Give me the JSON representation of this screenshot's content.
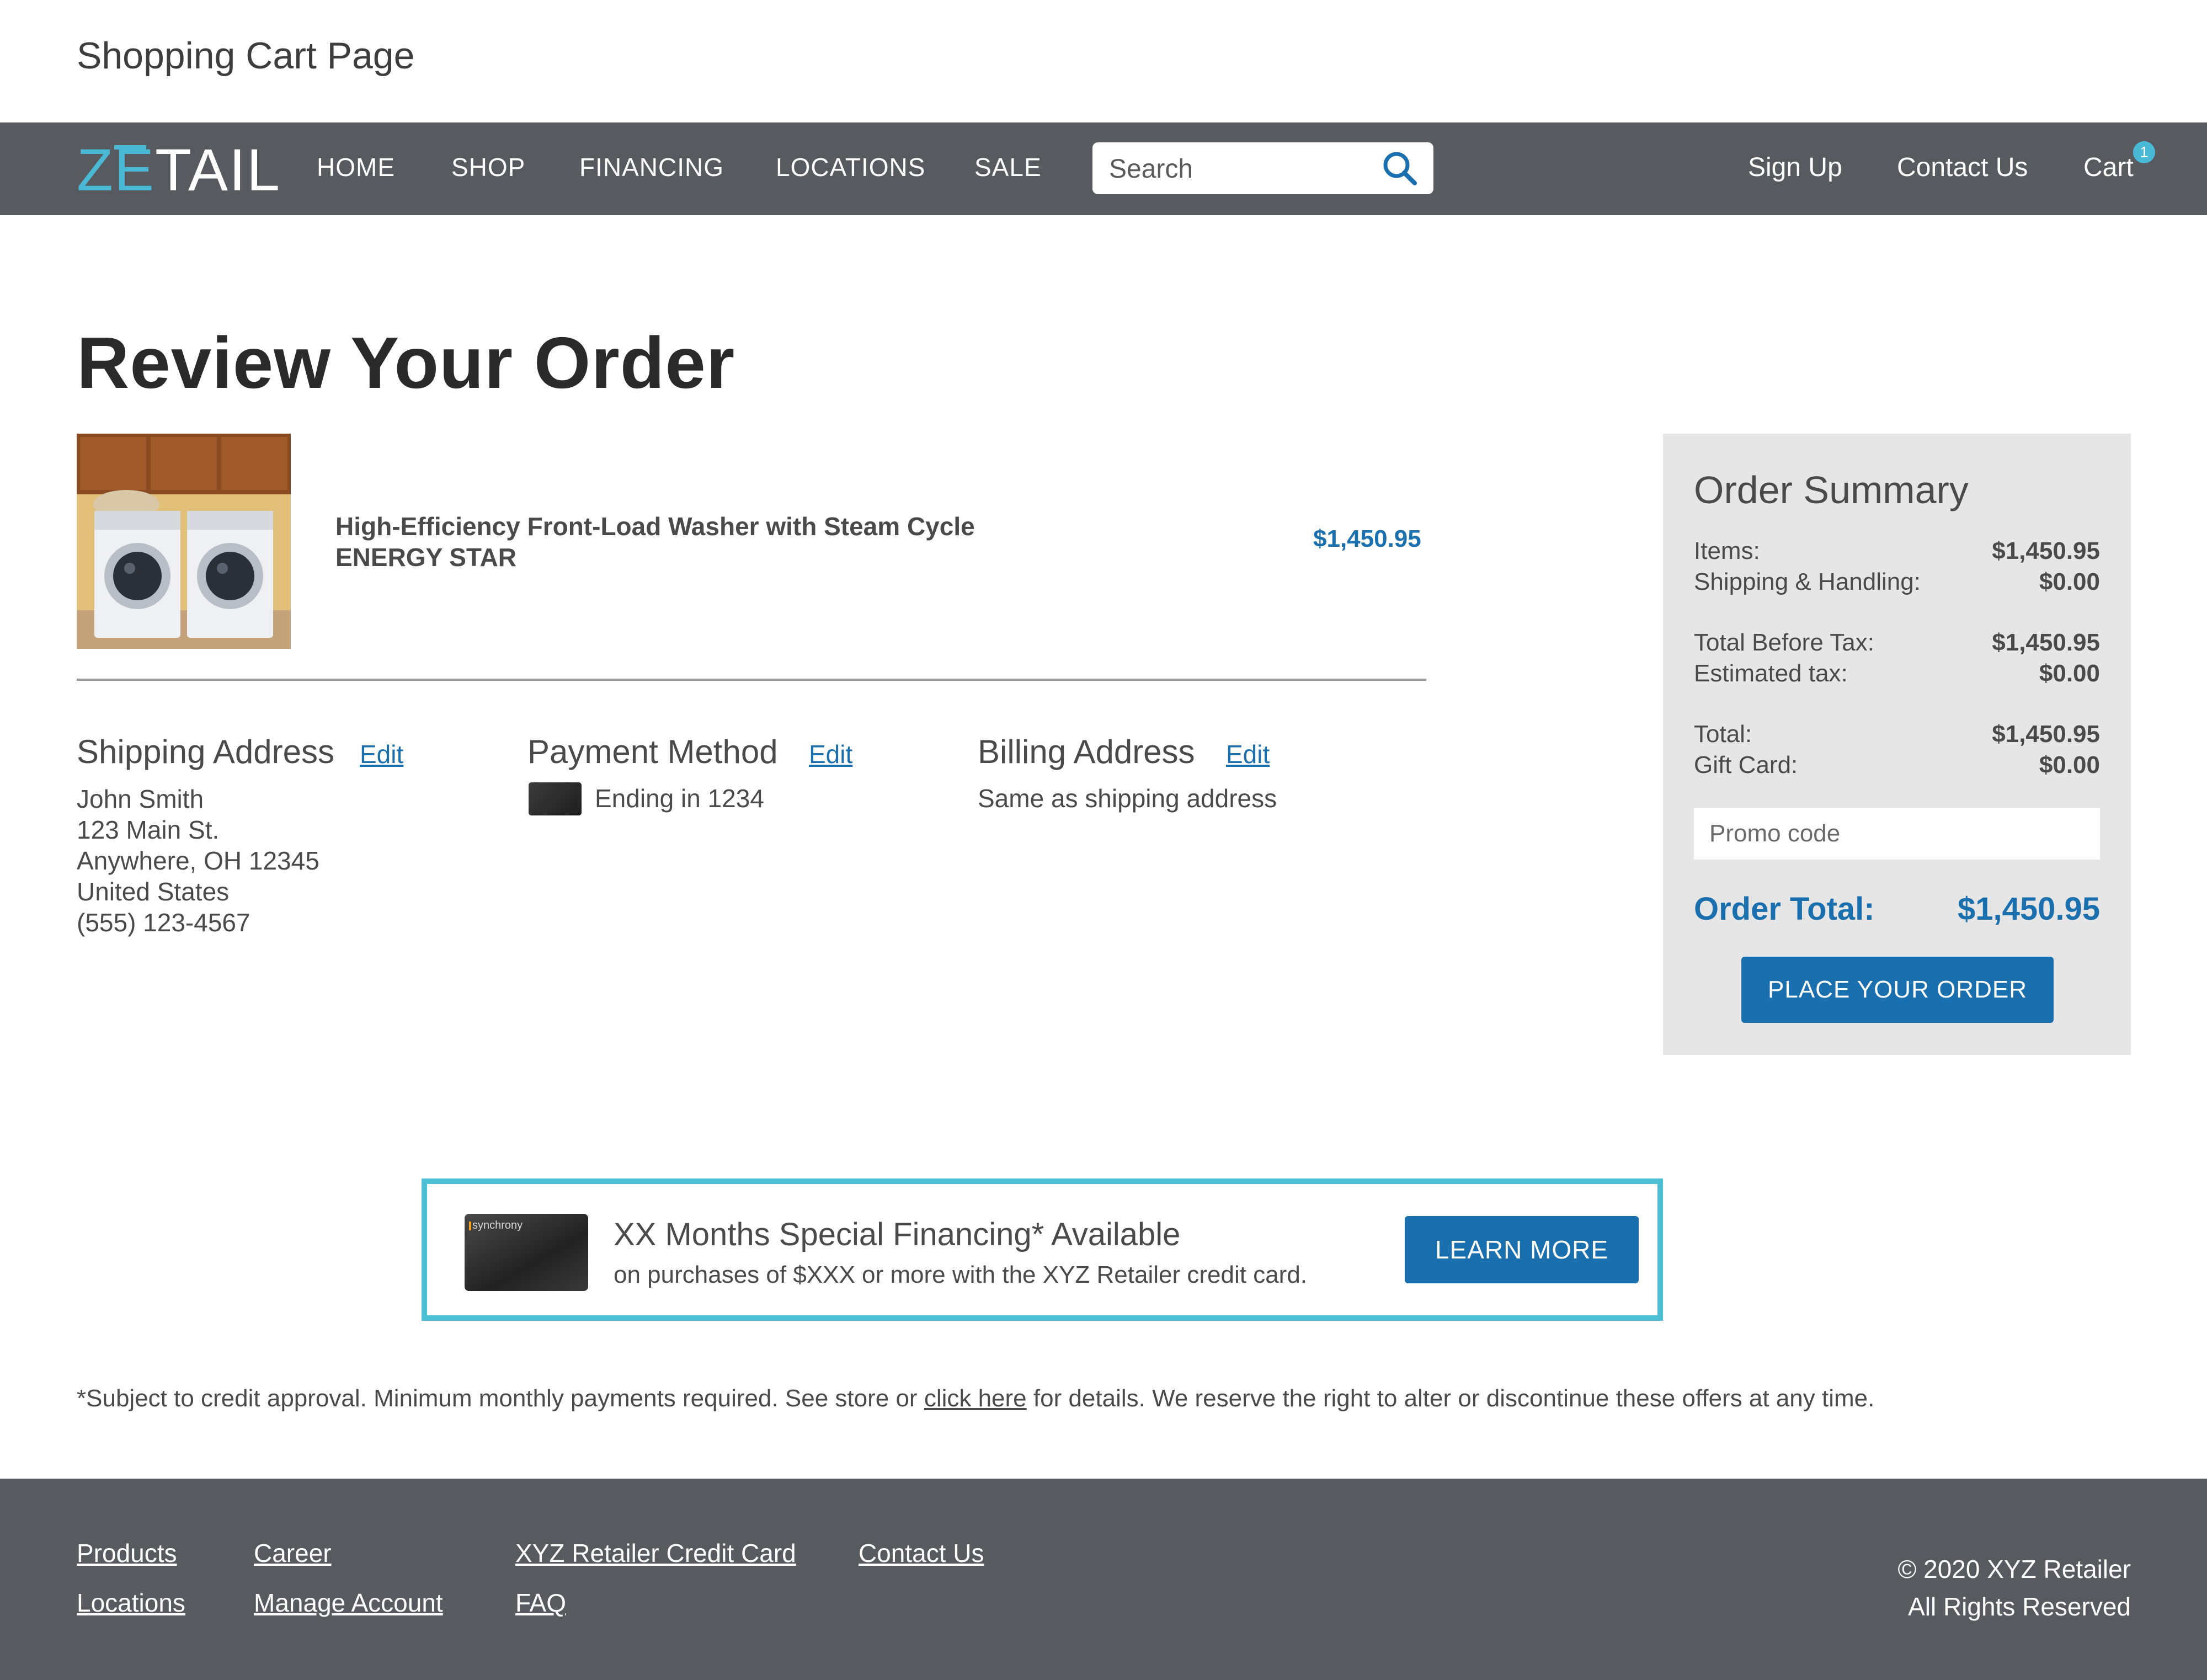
{
  "page_label": "Shopping Cart Page",
  "header": {
    "logo": {
      "part1": "ZE",
      "part2": "TAIL"
    },
    "nav": [
      "HOME",
      "SHOP",
      "FINANCING",
      "LOCATIONS",
      "SALE"
    ],
    "search": {
      "placeholder": "Search",
      "value": ""
    },
    "links": {
      "sign_up": "Sign Up",
      "contact": "Contact Us",
      "cart": "Cart"
    },
    "cart_count": "1"
  },
  "main": {
    "title": "Review Your Order",
    "product": {
      "name_line1": "High-Efficiency Front-Load Washer with Steam Cycle",
      "name_line2": "ENERGY STAR",
      "price": "$1,450.95"
    },
    "shipping": {
      "title": "Shipping Address",
      "edit": "Edit",
      "lines": [
        "John Smith",
        "123 Main St.",
        "Anywhere, OH 12345",
        "United States",
        "(555) 123-4567"
      ]
    },
    "payment": {
      "title": "Payment Method",
      "edit": "Edit",
      "text": "Ending in 1234"
    },
    "billing": {
      "title": "Billing Address",
      "edit": "Edit",
      "text": "Same as shipping address"
    }
  },
  "summary": {
    "title": "Order Summary",
    "rows": [
      {
        "label": "Items:",
        "value": "$1,450.95"
      },
      {
        "label": "Shipping & Handling:",
        "value": "$0.00"
      },
      {
        "label": "Total Before Tax:",
        "value": "$1,450.95"
      },
      {
        "label": "Estimated tax:",
        "value": "$0.00"
      },
      {
        "label": "Total:",
        "value": "$1,450.95"
      },
      {
        "label": "Gift Card:",
        "value": "$0.00"
      }
    ],
    "promo_placeholder": "Promo code",
    "order_total_label": "Order Total:",
    "order_total_value": "$1,450.95",
    "place_order": "PLACE YOUR ORDER"
  },
  "banner": {
    "card_brand": "synchrony",
    "title": "XX Months Special Financing* Available",
    "subtitle": "on purchases of $XXX or more with the XYZ Retailer credit card.",
    "button": "LEARN MORE"
  },
  "disclaimer": {
    "before": "*Subject to credit approval. Minimum monthly payments required. See store or ",
    "link": "click here",
    "after": " for details. We reserve the right to alter or discontinue these offers at any time."
  },
  "footer": {
    "col1": [
      "Products",
      "Locations"
    ],
    "col2": [
      "Career",
      "Manage Account"
    ],
    "col3": [
      "XYZ Retailer Credit Card",
      "FAQ"
    ],
    "col4": [
      "Contact Us"
    ],
    "copyright_line1": "© 2020 XYZ Retailer",
    "copyright_line2": "All Rights Reserved"
  },
  "colors": {
    "brand": "#4ab9d6",
    "accent": "#1a6fae",
    "nav_bg": "#575b5f",
    "summary_bg": "#e6e6e6"
  }
}
